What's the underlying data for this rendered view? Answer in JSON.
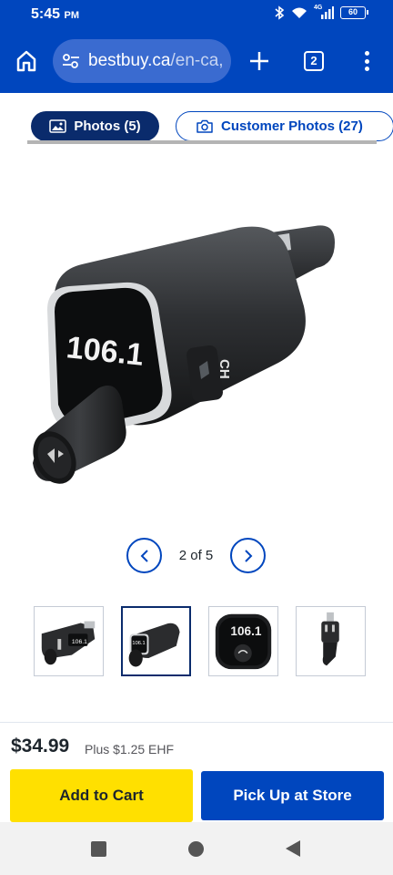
{
  "status_bar": {
    "time": "5:45",
    "ampm": "PM",
    "network": "4G",
    "battery": "60",
    "icons": [
      "bluetooth-icon",
      "wifi-icon",
      "signal-icon",
      "battery-icon"
    ]
  },
  "browser": {
    "url_domain": "bestbuy.ca",
    "url_path": "/en-ca,",
    "tab_count": "2",
    "icons": [
      "home-icon",
      "site-settings-icon",
      "plus-icon",
      "tabs-icon",
      "more-vert-icon"
    ]
  },
  "photo_tabs": {
    "photos_label": "Photos (5)",
    "customer_photos_label": "Customer Photos (27)"
  },
  "product": {
    "display_text": "106.1",
    "knob_label": "CH"
  },
  "gallery": {
    "position_text": "2 of 5",
    "current": 2,
    "total": 5,
    "thumbnails": [
      {
        "name": "thumb-1",
        "selected": false
      },
      {
        "name": "thumb-2",
        "selected": true
      },
      {
        "name": "thumb-3",
        "selected": false
      },
      {
        "name": "thumb-4",
        "selected": false
      }
    ]
  },
  "purchase": {
    "price": "$34.99",
    "ehf": "Plus $1.25 EHF",
    "add_to_cart": "Add to Cart",
    "pickup": "Pick Up at Store"
  },
  "colors": {
    "brand_blue": "#0046be",
    "dark_navy": "#0a2b6c",
    "cart_yellow": "#ffe000"
  }
}
